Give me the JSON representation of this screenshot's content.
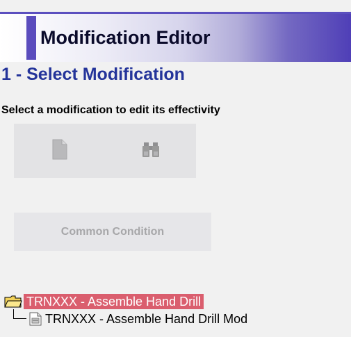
{
  "header": {
    "title": "Modification Editor"
  },
  "section": {
    "title": "1 - Select Modification",
    "instruction": "Select a modification to edit its effectivity"
  },
  "toolbar": {
    "new_icon": "new-document-icon",
    "find_icon": "binoculars-icon"
  },
  "buttons": {
    "common_condition": "Common Condition"
  },
  "tree": {
    "root": {
      "icon": "folder-icon",
      "label": "TRNXXX - Assemble Hand Drill",
      "selected": true
    },
    "children": [
      {
        "icon": "modification-document-icon",
        "label": "TRNXXX - Assemble Hand Drill Mod"
      }
    ]
  },
  "colors": {
    "title_accent": "#4f3fb7",
    "section_title": "#24349a",
    "selection": "#da5e6e",
    "panel_background": "#f1f1f1"
  }
}
